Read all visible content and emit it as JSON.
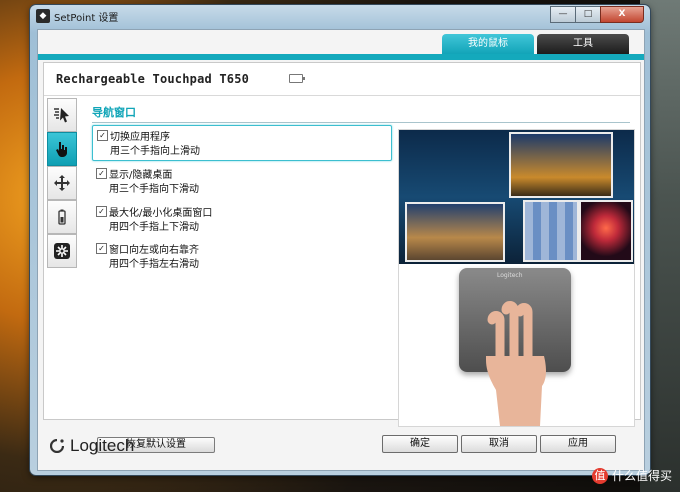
{
  "window": {
    "title": "SetPoint 设置",
    "min": "—",
    "max": "□",
    "close": "X"
  },
  "tabs": [
    {
      "label": "我的鼠标"
    },
    {
      "label": "工具"
    }
  ],
  "device": {
    "name": "Rechargeable Touchpad T650"
  },
  "section": {
    "title": "导航窗口"
  },
  "options": [
    {
      "label": "切换应用程序",
      "desc": "用三个手指向上滑动",
      "checked": "✓"
    },
    {
      "label": "显示/隐藏桌面",
      "desc": "用三个手指向下滑动",
      "checked": "✓"
    },
    {
      "label": "最大化/最小化桌面窗口",
      "desc": "用四个手指上下滑动",
      "checked": "✓"
    },
    {
      "label": "窗口向左或向右靠齐",
      "desc": "用四个手指左右滑动",
      "checked": "✓"
    }
  ],
  "preview": {
    "pad_brand": "Logitech"
  },
  "restore_label": "恢复默认设置",
  "footer": {
    "brand": "Logitech",
    "ok": "确定",
    "cancel": "取消",
    "apply": "应用"
  },
  "watermark": {
    "badge": "值",
    "text": "什么值得买"
  },
  "colors": {
    "accent": "#14a9bc",
    "tab_dark": "#1c1c1c",
    "title_blue": "#11a5b8"
  }
}
